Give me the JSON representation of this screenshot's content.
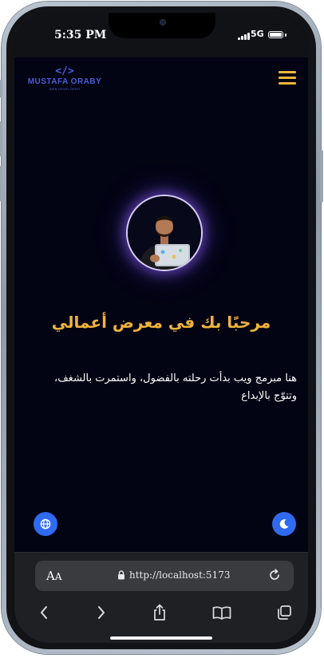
{
  "status_bar": {
    "time": "5:35 PM",
    "network": "5G"
  },
  "header": {
    "logo_code": "</>",
    "logo_name": "MUSTAFA ORABY",
    "logo_subtitle": "WEB DEVELOPER"
  },
  "hero": {
    "title": "مرحبًا بك في معرض أعمالي",
    "description": "هنا مبرمج ويب بدأت رحلته بالفضول، واستمرت بالشغف، وتتوّج بالإبداع"
  },
  "browser": {
    "text_size_big": "A",
    "text_size_small": "A",
    "url": "http://localhost:5173"
  },
  "icons": {
    "menu": "hamburger-icon",
    "language": "globe-icon",
    "theme": "moon-icon",
    "back": "chevron-left-icon",
    "forward": "chevron-right-icon",
    "share": "share-icon",
    "bookmarks": "book-icon",
    "tabs": "tabs-icon"
  },
  "colors": {
    "accent": "#f0b43a",
    "fab": "#2f6bf0",
    "logo": "#4a5ed8",
    "page_bg": "#020313",
    "glow": "#8a5cf5"
  }
}
